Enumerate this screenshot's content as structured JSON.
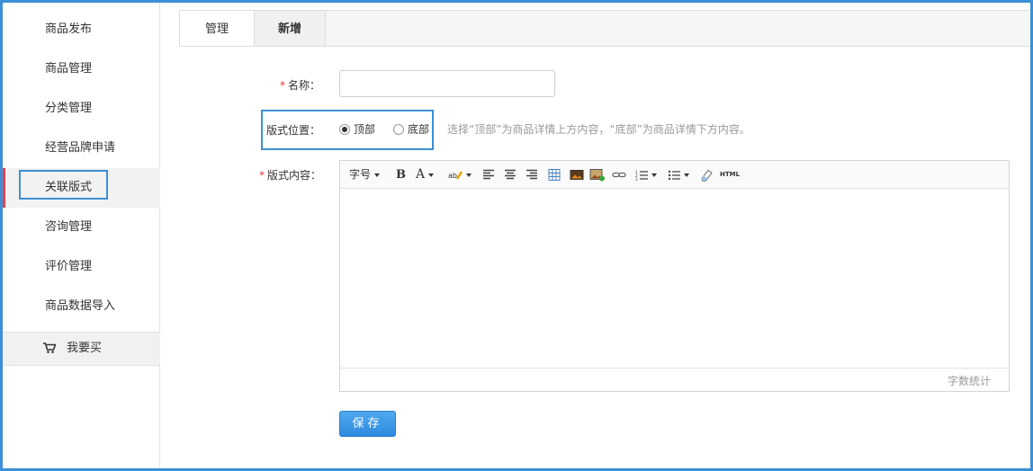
{
  "sidebar": {
    "items": [
      {
        "label": "商品发布"
      },
      {
        "label": "商品管理"
      },
      {
        "label": "分类管理"
      },
      {
        "label": "经营品牌申请"
      },
      {
        "label": "关联版式"
      },
      {
        "label": "咨询管理"
      },
      {
        "label": "评价管理"
      },
      {
        "label": "商品数据导入"
      }
    ],
    "buy_label": "我要买"
  },
  "tabs": [
    {
      "label": "管理"
    },
    {
      "label": "新增"
    }
  ],
  "form": {
    "name_label": "名称：",
    "position_label": "版式位置：",
    "position_options": [
      "顶部",
      "底部"
    ],
    "position_selected": "顶部",
    "position_hint": "选择“顶部”为商品详情上方内容，“底部”为商品详情下方内容。",
    "content_label": "版式内容：",
    "required_mark": "*"
  },
  "editor": {
    "font_size_label": "字号",
    "bold_label": "B",
    "font_color_label": "A",
    "html_label": "HTML",
    "word_count_label": "字数统计"
  },
  "save_label": "保存"
}
